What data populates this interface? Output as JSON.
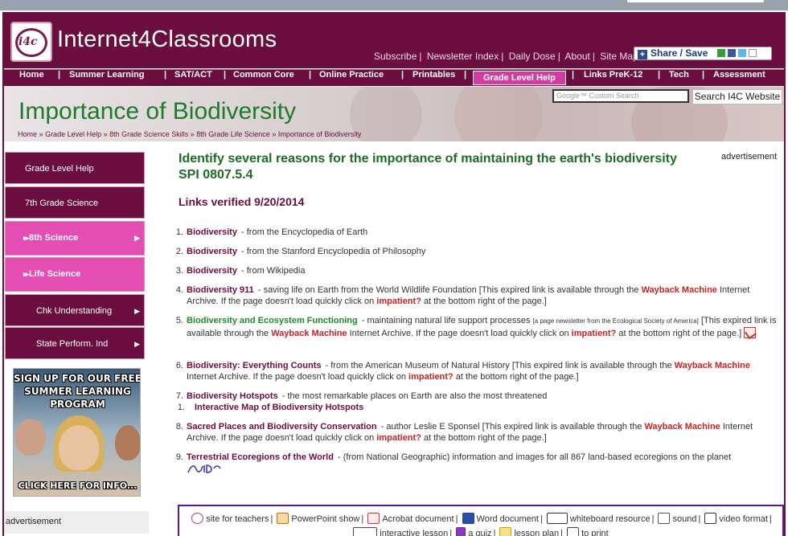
{
  "site": {
    "brand": "Internet4Classrooms",
    "logo_text": "i4c"
  },
  "header": {
    "links": [
      "Subscribe",
      "Newsletter Index",
      "Daily Dose",
      "About",
      "Site Map"
    ],
    "separator": "|",
    "share_label": "Share / Save"
  },
  "nav": {
    "items": [
      "Home",
      "Summer Learning",
      "SAT/ACT",
      "Common Core",
      "Online Practice",
      "Printables",
      "Grade Level Help",
      "Links PreK-12",
      "Tech",
      "Assessment"
    ],
    "separator": "|",
    "active": "Grade Level Help"
  },
  "banner": {
    "title": "Importance of Biodiversity",
    "breadcrumbs": [
      "Home",
      "Grade Level Help",
      "8th Grade Science Skills",
      "8th Grade Life Science",
      "Importance of Biodiversity"
    ],
    "crumb_sep": "»",
    "search_placeholder": "Google™ Custom Search",
    "search_button": "Search I4C Website"
  },
  "sidebar": {
    "items": [
      {
        "label": "Grade Level Help",
        "style": "dark",
        "arrow": false
      },
      {
        "label": "7th Grade Science",
        "style": "dark",
        "arrow": false
      },
      {
        "label": "8th Science",
        "style": "pink",
        "arrow": true
      },
      {
        "label": "Life Science",
        "style": "pink",
        "arrow": false
      },
      {
        "label": "Chk Understanding",
        "style": "dark",
        "arrow": true
      },
      {
        "label": "State Perform. Ind",
        "style": "dark",
        "arrow": true
      }
    ],
    "promo_headline": "SIGN UP FOR OUR FREE SUMMER LEARNING PROGRAM",
    "promo_cta": "CLICK HERE FOR INFO...",
    "advertisement": "advertisement"
  },
  "main": {
    "heading": "Identify several reasons for the importance of maintaining the earth's biodiversity SPI 0807.5.4",
    "verified": "Links verified 9/20/2014",
    "advertisement": "advertisement",
    "wayback_prefix": "[This expired link is available through the",
    "wayback_label": "Wayback Machine",
    "wayback_mid": "Internet Archive. If the page doesn't load quickly click on",
    "impatient_label": "impatient?",
    "wayback_end": "at the bottom right of the page.]",
    "links": [
      {
        "num": "1.",
        "title": "Biodiversity",
        "desc": "- from the Encyclopedia of Earth"
      },
      {
        "num": "2.",
        "title": "Biodiversity",
        "desc": "- from the Stanford Encyclopedia of Philosophy"
      },
      {
        "num": "3.",
        "title": "Biodiversity",
        "desc": "- from Wikipedia"
      },
      {
        "num": "4.",
        "title": "Biodiversity 911",
        "desc": "- saving life on Earth from the World Wildlife Foundation"
      },
      {
        "num": "5.",
        "title": "Biodiversity and Ecosystem Functioning",
        "desc": "- maintaining natural life support processes",
        "note": "[a page newsletter from the Ecological Society of America]"
      },
      {
        "num": "6.",
        "title": "Biodiversity: Everything Counts",
        "desc": "- from the American Museum of Natural History"
      },
      {
        "num": "7.",
        "title": "Biodiversity Hotspots",
        "desc": "- the most remarkable places on Earth are also the most threatened",
        "sub_num": "1.",
        "sub_title": "Interactive Map of Biodiversity Hotspots"
      },
      {
        "num": "8.",
        "title": "Sacred Places and Biodiversity Conservation",
        "desc": "- author Leslie E Sponsel"
      },
      {
        "num": "9.",
        "title": "Terrestrial Ecoregions of the World",
        "desc": "- (from National Geographic) information and images for all 867 land-based ecoregions on the planet"
      }
    ]
  },
  "legend": {
    "items": [
      "site for teachers",
      "PowerPoint show",
      "Acrobat document",
      "Word document",
      "whiteboard resource",
      "sound",
      "video format",
      "interactive lesson",
      "a quiz",
      "lesson plan",
      "to print"
    ],
    "separator": "|"
  }
}
